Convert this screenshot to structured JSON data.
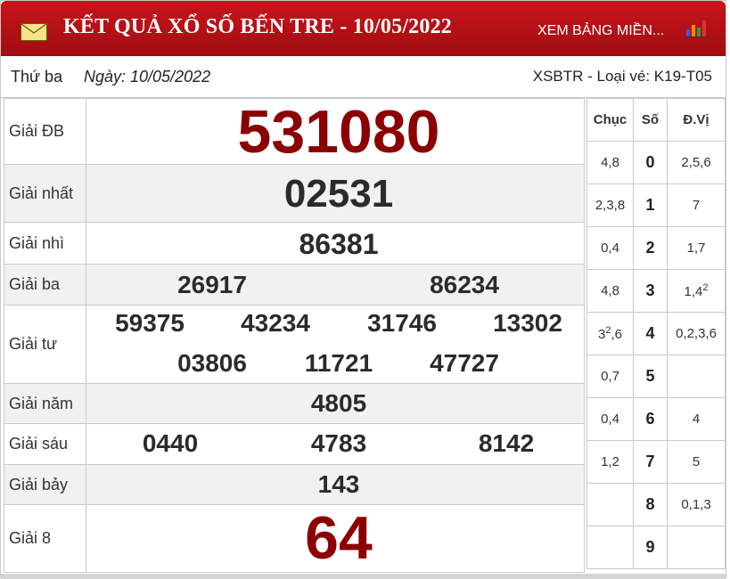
{
  "header": {
    "title": "KẾT QUẢ XỔ SỐ BẾN TRE - 10/05/2022",
    "link": "XEM BẢNG MIỀN...",
    "mail_icon": "mail-icon",
    "chart_icon": "bar-chart-icon"
  },
  "subbar": {
    "day": "Thứ ba",
    "date": "Ngày: 10/05/2022",
    "code": "XSBTR - Loại vé: K19-T05"
  },
  "prizes": [
    {
      "label": "Giải ĐB",
      "numbers": [
        "531080"
      ]
    },
    {
      "label": "Giải nhất",
      "numbers": [
        "02531"
      ]
    },
    {
      "label": "Giải nhì",
      "numbers": [
        "86381"
      ]
    },
    {
      "label": "Giải ba",
      "numbers": [
        "26917",
        "86234"
      ]
    },
    {
      "label": "Giải tư",
      "numbers": [
        "59375",
        "43234",
        "31746",
        "13302",
        "03806",
        "11721",
        "47727"
      ]
    },
    {
      "label": "Giải năm",
      "numbers": [
        "4805"
      ]
    },
    {
      "label": "Giải sáu",
      "numbers": [
        "0440",
        "4783",
        "8142"
      ]
    },
    {
      "label": "Giải bảy",
      "numbers": [
        "143"
      ]
    },
    {
      "label": "Giải 8",
      "numbers": [
        "64"
      ]
    }
  ],
  "loto": {
    "headers": [
      "Chục",
      "Số",
      "Đ.Vị"
    ],
    "rows": [
      {
        "chuc": "4,8",
        "so": "0",
        "dvi": "2,5,6"
      },
      {
        "chuc": "2,3,8",
        "so": "1",
        "dvi": "7"
      },
      {
        "chuc": "0,4",
        "so": "2",
        "dvi": "1,7"
      },
      {
        "chuc": "4,8",
        "so": "3",
        "dvi": "1,4",
        "dvi_sup": "2"
      },
      {
        "chuc": "3",
        "chuc_sup": "2",
        "chuc_rest": ",6",
        "so": "4",
        "dvi": "0,2,3,6"
      },
      {
        "chuc": "0,7",
        "so": "5",
        "dvi": ""
      },
      {
        "chuc": "0,4",
        "so": "6",
        "dvi": "4"
      },
      {
        "chuc": "1,2",
        "so": "7",
        "dvi": "5"
      },
      {
        "chuc": "",
        "so": "8",
        "dvi": "0,1,3"
      },
      {
        "chuc": "",
        "so": "9",
        "dvi": ""
      }
    ]
  },
  "colors": {
    "header_red": "#b3121a",
    "special_red": "#8b0000",
    "alt_row": "#f1f1f1"
  }
}
